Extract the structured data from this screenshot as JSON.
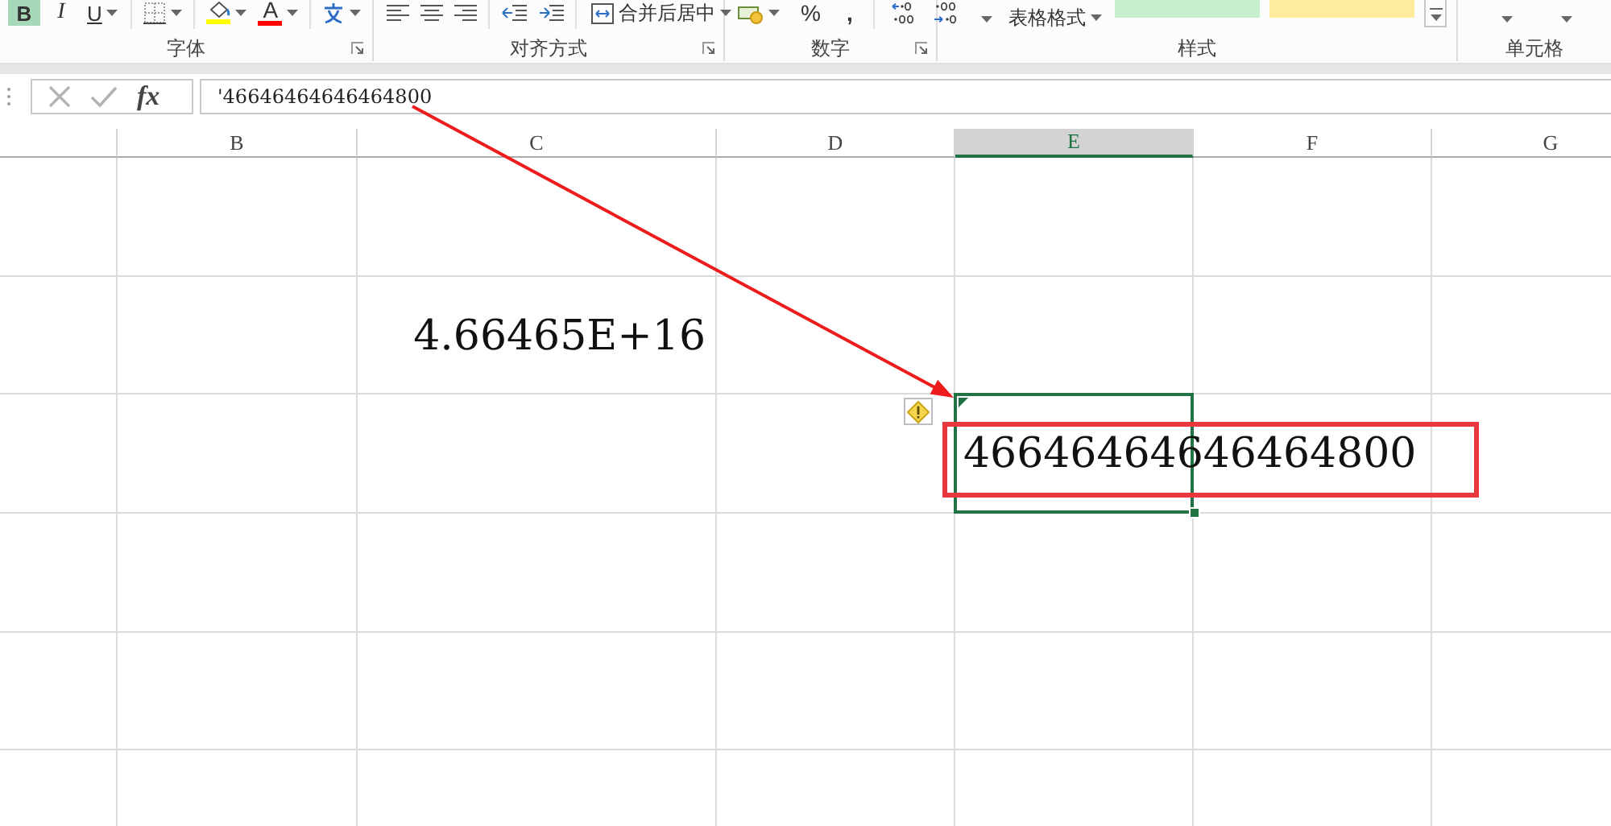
{
  "ribbon": {
    "groups": [
      {
        "label": "字体",
        "launcher": true,
        "controls": [
          {
            "kind": "bold",
            "label": "B",
            "on": true,
            "dropdown": false
          },
          {
            "kind": "italic",
            "label": "I",
            "on": false,
            "dropdown": false
          },
          {
            "kind": "underline",
            "label": "U",
            "on": false,
            "dropdown": true
          },
          {
            "kind": "separator"
          },
          {
            "kind": "borders",
            "dropdown": true
          },
          {
            "kind": "separator"
          },
          {
            "kind": "fill_color",
            "color": "#ffff00",
            "dropdown": true
          },
          {
            "kind": "font_color",
            "label": "A",
            "color": "#ff0000",
            "dropdown": true
          },
          {
            "kind": "separator"
          },
          {
            "kind": "phonetic",
            "dropdown": true
          }
        ]
      },
      {
        "label": "对齐方式",
        "launcher": true,
        "controls": [
          {
            "kind": "align_left",
            "dropdown": false
          },
          {
            "kind": "align_center",
            "dropdown": false
          },
          {
            "kind": "align_right",
            "dropdown": false
          },
          {
            "kind": "separator"
          },
          {
            "kind": "indent_decrease",
            "dropdown": false
          },
          {
            "kind": "indent_increase",
            "dropdown": false
          },
          {
            "kind": "separator"
          },
          {
            "kind": "merge",
            "label": "合并后居中",
            "dropdown": true
          }
        ]
      },
      {
        "label": "数字",
        "launcher": true,
        "controls": [
          {
            "kind": "currency",
            "dropdown": true
          },
          {
            "kind": "percent",
            "label": "%",
            "dropdown": false
          },
          {
            "kind": "comma",
            "label": ",",
            "dropdown": false
          },
          {
            "kind": "separator"
          },
          {
            "kind": "increase_decimal",
            "dropdown": false
          },
          {
            "kind": "decrease_decimal",
            "dropdown": false
          }
        ]
      },
      {
        "label": "样式",
        "launcher": false,
        "controls": [
          {
            "kind": "menu_button",
            "dropdown": true
          },
          {
            "kind": "table_format",
            "label": "表格格式",
            "dropdown": true
          },
          {
            "kind": "style_tile",
            "color": "#c6efce"
          },
          {
            "kind": "style_tile",
            "color": "#ffeb9c"
          },
          {
            "kind": "gallery_more"
          }
        ]
      },
      {
        "label": "单元格",
        "launcher": false,
        "controls": [
          {
            "kind": "menu_button",
            "dropdown": true
          },
          {
            "kind": "menu_button",
            "dropdown": true
          }
        ]
      }
    ]
  },
  "formula_bar": {
    "buttons": [
      {
        "kind": "cancel",
        "disabled": true
      },
      {
        "kind": "enter",
        "disabled": true
      },
      {
        "kind": "function",
        "label": "fx",
        "disabled": false
      }
    ],
    "value": "'46646464646464800"
  },
  "sheet": {
    "columns": [
      {
        "kind": "cut",
        "selected": false
      },
      {
        "kind": "full",
        "label": "B",
        "selected": false
      },
      {
        "kind": "full",
        "label": "C",
        "selected": false
      },
      {
        "kind": "full",
        "label": "D",
        "selected": false
      },
      {
        "kind": "full",
        "label": "E",
        "selected": true
      },
      {
        "kind": "full",
        "label": "F",
        "selected": false
      },
      {
        "kind": "full",
        "label": "G",
        "selected": false
      }
    ],
    "cells": [
      {
        "kind": "number",
        "value": "4.66465E+16",
        "selected": false,
        "error_flag": false
      },
      {
        "kind": "text",
        "value": "46646464646464800",
        "selected": true,
        "error_flag": true
      }
    ]
  },
  "annotations": {
    "arrow": true,
    "frame": true
  }
}
